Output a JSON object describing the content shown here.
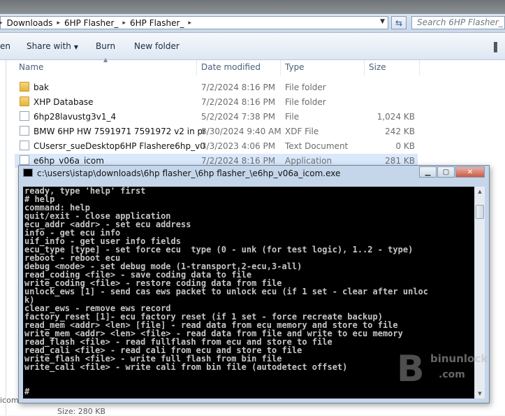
{
  "address_bar": {
    "crumbs": [
      "Downloads",
      "6HP Flasher_",
      "6HP Flasher_"
    ],
    "search_placeholder": "Search 6HP Flasher_"
  },
  "toolbar": {
    "partial_first": "en",
    "share_with": "Share with",
    "burn": "Burn",
    "new_folder": "New folder"
  },
  "columns": {
    "name": "Name",
    "date_modified": "Date modified",
    "type": "Type",
    "size": "Size"
  },
  "files": [
    {
      "name": "bak",
      "date": "7/2/2024 8:16 PM",
      "type": "File folder",
      "size": "",
      "icon": "folder-icon"
    },
    {
      "name": "XHP Database",
      "date": "7/2/2024 8:16 PM",
      "type": "File folder",
      "size": "",
      "icon": "folder-icon"
    },
    {
      "name": "6hp28lavustg3v1_4",
      "date": "5/2/2024 7:38 PM",
      "type": "File",
      "size": "1,024 KB",
      "icon": "file-icon"
    },
    {
      "name": "BMW 6HP HW 7591971 7591972 v2 in pro...",
      "date": "8/30/2024 9:40 AM",
      "type": "XDF File",
      "size": "242 KB",
      "icon": "file-icon"
    },
    {
      "name": "CUsersr_sueDesktop6HP Flashere6hp_v06...",
      "date": "3/3/2023 4:06 PM",
      "type": "Text Document",
      "size": "0 KB",
      "icon": "text-file-icon"
    },
    {
      "name": "e6hp_v06a_icom",
      "date": "7/2/2024 8:16 PM",
      "type": "Application",
      "size": "281 KB",
      "icon": "app-icon"
    }
  ],
  "status": {
    "left_fragment": "icom",
    "size_label": "Size: 280 KB"
  },
  "console": {
    "title": "c:\\users\\istap\\downloads\\6hp flasher_\\6hp flasher_\\e6hp_v06a_icom.exe",
    "lines": [
      "ready, type 'help' first",
      "# help",
      "command: help",
      "quit/exit - close application",
      "ecu_addr <addr> - set ecu address",
      "info - get ecu info",
      "uif_info - get user info fields",
      "ecu_type [type] - set force ecu  type (0 - unk (for test logic), 1..2 - type)",
      "reboot - reboot ecu",
      "debug <mode> - set debug mode (1-transport,2-ecu,3-all)",
      "read_coding <file> - save coding data to file",
      "write_coding <file> - restore coding data from file",
      "unlock_ews [1] - send cas ews packet to unlock ecu (if 1 set - clear after unloc",
      "k)",
      "clear_ews - remove ews record",
      "factory_reset [1]- ecu factory reset (if 1 set - force recreate backup)",
      "read_mem <addr> <len> [file] - read data from ecu memory and store to file",
      "write_mem <addr> <len> <file> - read data from file and write to ecu memory",
      "read_flash <file> - read fullflash from ecu and store to file",
      "read_cali <file> - read cali from ecu and store to file",
      "write_flash <file> - write full flash from bin file",
      "write_cali <file> - write cali from bin file (autodetect offset)"
    ],
    "prompt": "#"
  },
  "watermark": {
    "line1": "binunlock",
    "line2": ".com"
  }
}
